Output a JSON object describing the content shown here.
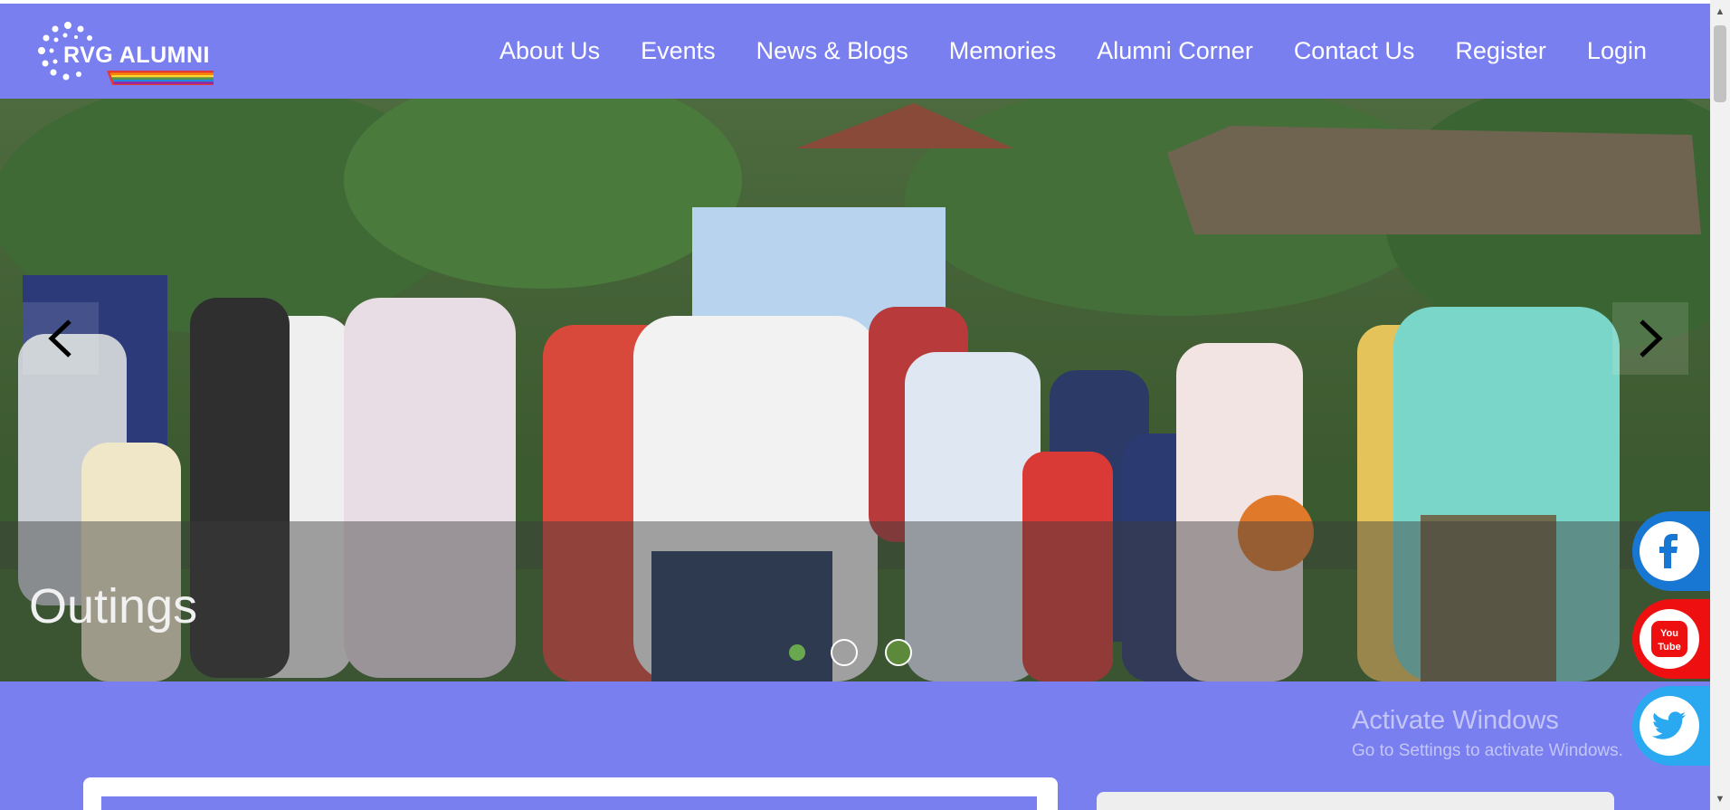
{
  "header": {
    "logo_text": "RVG ALUMNI",
    "nav": [
      "About Us",
      "Events",
      "News & Blogs",
      "Memories",
      "Alumni Corner",
      "Contact Us",
      "Register",
      "Login"
    ]
  },
  "hero": {
    "caption": "Outings",
    "slide_count": 3,
    "active_slide": 3
  },
  "social": [
    "facebook-icon",
    "youtube-icon",
    "twitter-icon"
  ],
  "activate_windows": {
    "title": "Activate Windows",
    "subtitle": "Go to Settings to activate Windows."
  },
  "colors": {
    "brand": "#7a7ff0",
    "facebook": "#1877d2",
    "youtube": "#ee1010",
    "twitter": "#2aa8f0"
  }
}
